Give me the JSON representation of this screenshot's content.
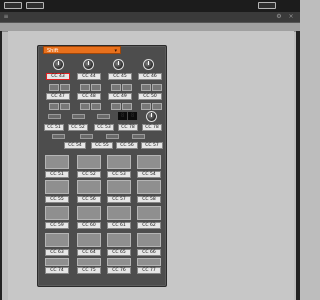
{
  "topbar": {
    "caption": ""
  },
  "device": {
    "shift_label": "Shift",
    "shift_arrow": "▾",
    "knob_labels": [
      "CC 43",
      "CC 44",
      "CC 45",
      "CC 46"
    ],
    "slider_labels": [
      "CC 47",
      "CC 48",
      "CC 49",
      "CC 50"
    ],
    "mini_buttons": [
      "",
      "",
      "",
      ""
    ],
    "row3_labels": [
      "CC 51",
      "CC 52",
      "CC 53",
      "CC 78",
      "CC 78"
    ],
    "row4_labels": [
      "CC 54",
      "CC 55",
      "CC 56",
      "CC 57"
    ],
    "display_digits": [
      "8",
      "8"
    ],
    "pad_rows": [
      [
        "CC 51",
        "CC 52",
        "CC 53",
        "CC 54"
      ],
      [
        "CC 55",
        "CC 56",
        "CC 57",
        "CC 58"
      ],
      [
        "CC 59",
        "CC 60",
        "CC 61",
        "CC 62"
      ],
      [
        "CC 63",
        "CC 64",
        "CC 65",
        "CC 66"
      ],
      [
        "CC 74",
        "CC 75",
        "CC 76",
        "CC 77"
      ]
    ]
  },
  "colors": {
    "accent": "#e8701c",
    "device_body": "#4d4d4d",
    "background": "#bdbdbd"
  }
}
